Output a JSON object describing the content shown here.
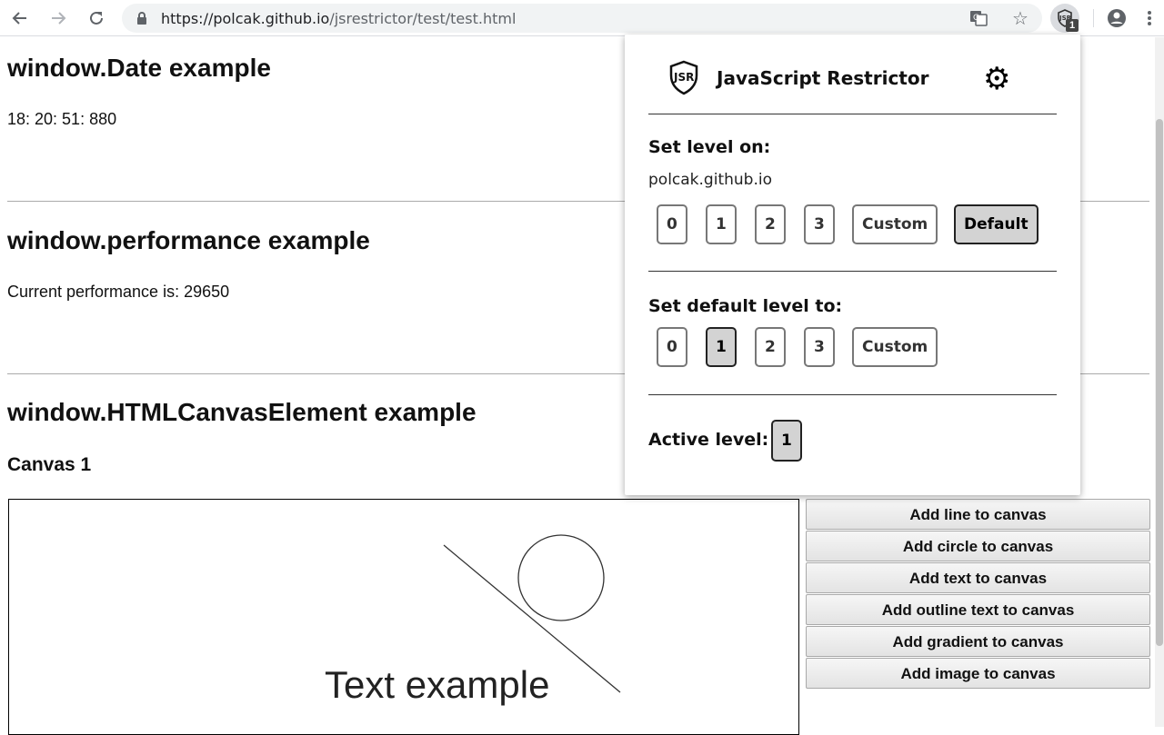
{
  "browser": {
    "url_host": "https://polcak.github.io",
    "url_path": "/jsrestrictor/test/test.html",
    "extension_badge": "1"
  },
  "page": {
    "date_heading": "window.Date example",
    "date_value": "18: 20: 51: 880",
    "perf_heading": "window.performance example",
    "perf_text": "Current performance is: 29650",
    "canvas_heading": "window.HTMLCanvasElement example",
    "canvas1_heading": "Canvas 1",
    "canvas_text": "Text example",
    "canvas_buttons": [
      "Add line to canvas",
      "Add circle to canvas",
      "Add text to canvas",
      "Add outline text to canvas",
      "Add gradient to canvas",
      "Add image to canvas"
    ]
  },
  "popup": {
    "title": "JavaScript Restrictor",
    "set_level_on_label": "Set level on:",
    "domain": "polcak.github.io",
    "site_levels": [
      "0",
      "1",
      "2",
      "3",
      "Custom",
      "Default"
    ],
    "site_selected": "Default",
    "set_default_label": "Set default level to:",
    "default_levels": [
      "0",
      "1",
      "2",
      "3",
      "Custom"
    ],
    "default_selected": "1",
    "active_level_label": "Active level:",
    "active_level": "1"
  }
}
